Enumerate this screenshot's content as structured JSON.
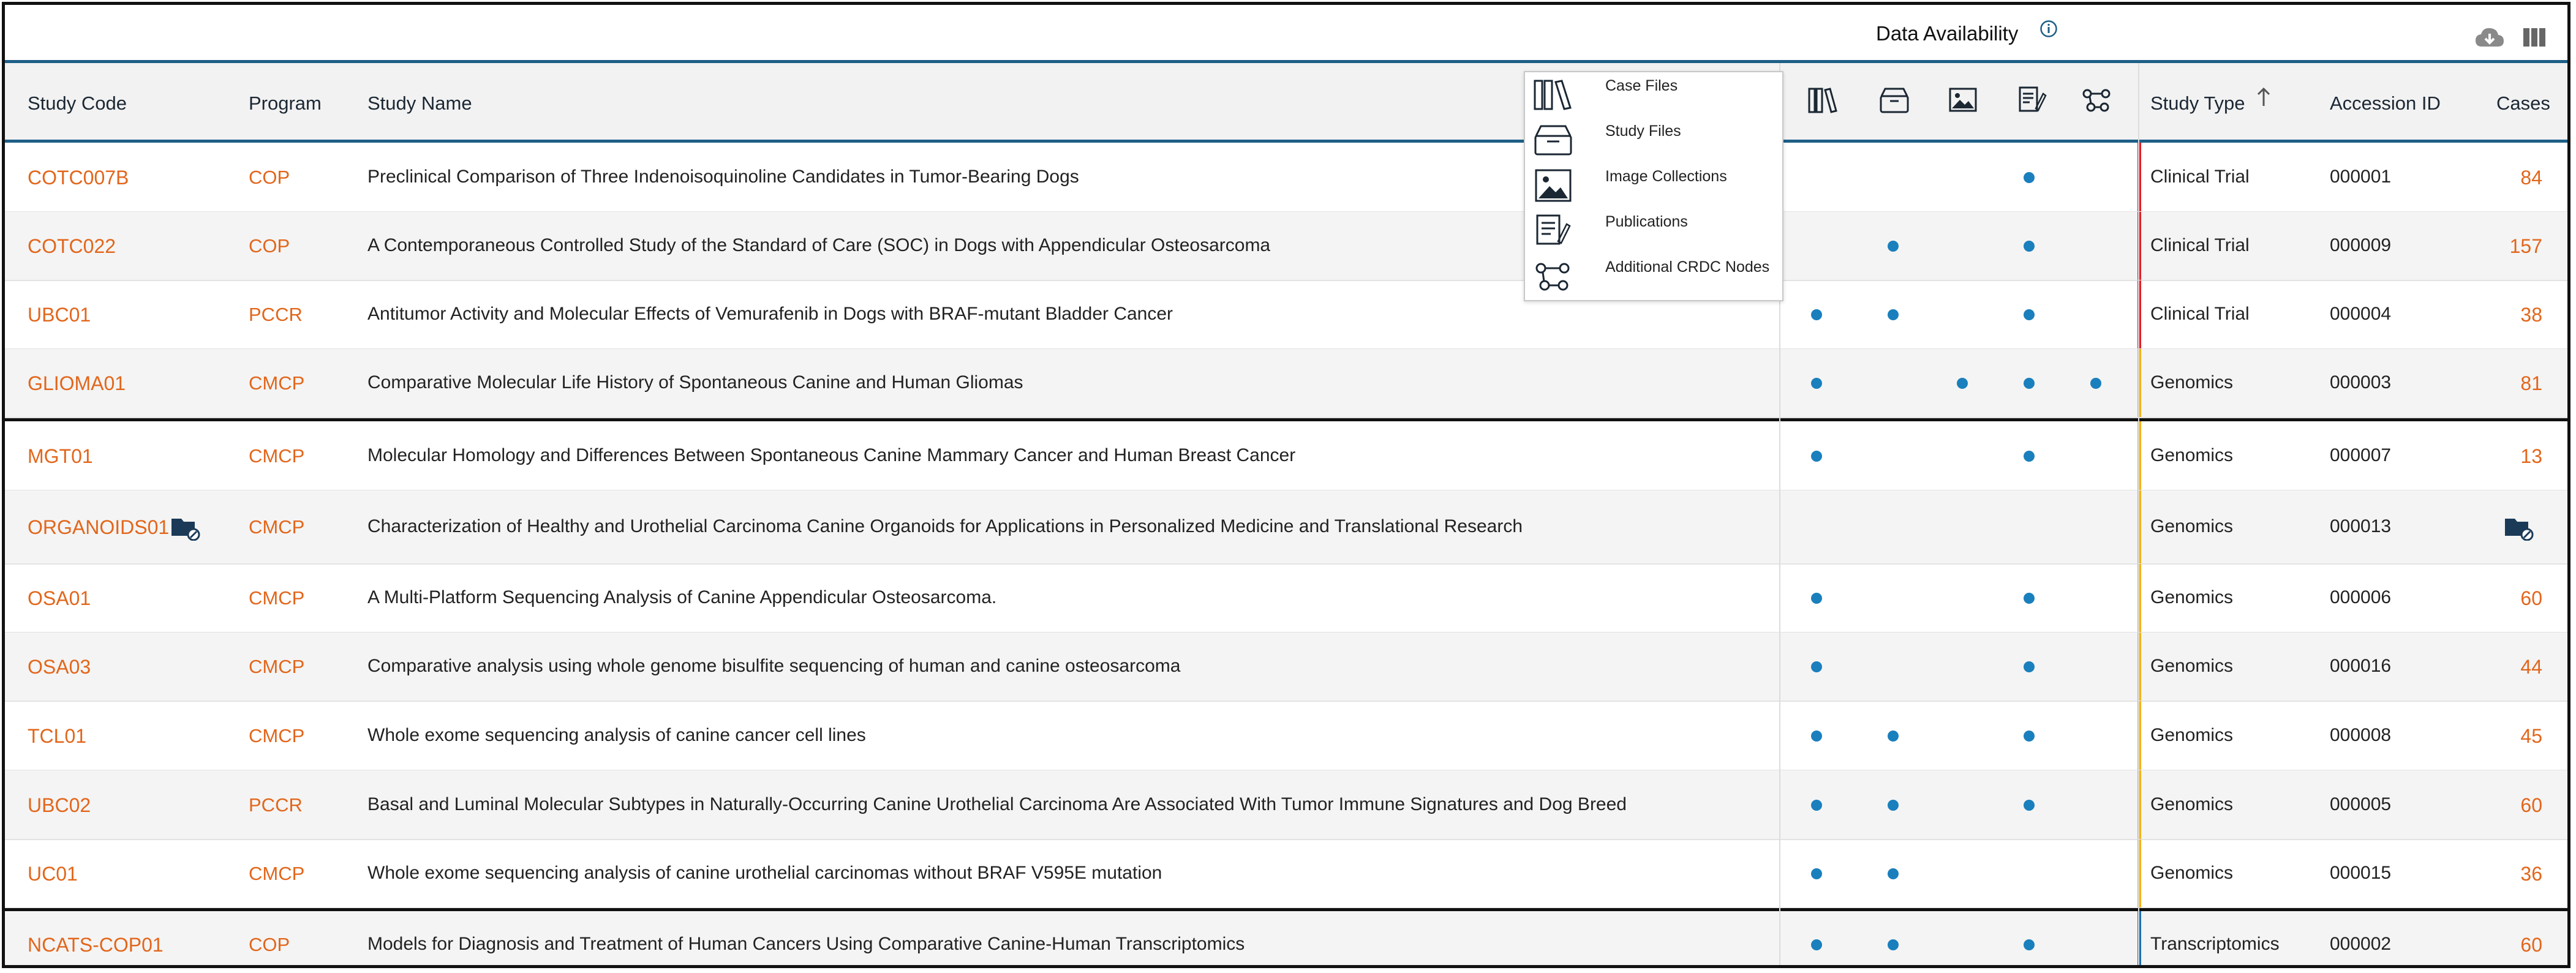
{
  "header": {
    "data_availability_title": "Data Availability",
    "columns": {
      "study_code": "Study Code",
      "program": "Program",
      "study_name": "Study Name",
      "study_type": "Study Type",
      "accession_id": "Accession ID",
      "cases": "Cases"
    },
    "data_icons": [
      "case-files-icon",
      "study-files-icon",
      "image-collections-icon",
      "publications-icon",
      "additional-crdc-nodes-icon"
    ],
    "sorted_column": "Study Type",
    "sort_direction": "ascending"
  },
  "legend": {
    "items": [
      {
        "icon": "case-files-icon",
        "label": "Case Files"
      },
      {
        "icon": "study-files-icon",
        "label": "Study Files"
      },
      {
        "icon": "image-collections-icon",
        "label": "Image Collections"
      },
      {
        "icon": "publications-icon",
        "label": "Publications"
      },
      {
        "icon": "additional-crdc-nodes-icon",
        "label": "Additional CRDC Nodes"
      }
    ]
  },
  "colors": {
    "accent": "#e2661b",
    "header_rule": "#1e5f87",
    "dot": "#1a7fbd",
    "clinical_trial_bar": "#e0202a",
    "genomics_bar": "#f2b21a",
    "transcriptomics_bar": "#1e6fb0"
  },
  "rows": [
    {
      "code": "COTC007B",
      "program": "COP",
      "name": "Preclinical Comparison of Three Indenoisoquinoline Candidates in Tumor-Bearing Dogs",
      "avail": [
        0,
        0,
        0,
        1,
        0
      ],
      "type": "Clinical Trial",
      "accession": "000001",
      "cases": "84"
    },
    {
      "code": "COTC022",
      "program": "COP",
      "name": "A Contemporaneous Controlled Study of the Standard of Care (SOC) in Dogs with Appendicular Osteosarcoma",
      "avail": [
        0,
        1,
        0,
        1,
        0
      ],
      "type": "Clinical Trial",
      "accession": "000009",
      "cases": "157"
    },
    {
      "code": "UBC01",
      "program": "PCCR",
      "name": "Antitumor Activity and Molecular Effects of Vemurafenib in Dogs with BRAF-mutant Bladder Cancer",
      "avail": [
        1,
        1,
        0,
        1,
        0
      ],
      "type": "Clinical Trial",
      "accession": "000004",
      "cases": "38"
    },
    {
      "code": "GLIOMA01",
      "program": "CMCP",
      "name": "Comparative Molecular Life History of Spontaneous Canine and Human Gliomas",
      "avail": [
        1,
        0,
        1,
        1,
        1
      ],
      "type": "Genomics",
      "accession": "000003",
      "cases": "81"
    },
    {
      "code": "MGT01",
      "program": "CMCP",
      "name": "Molecular Homology and Differences Between Spontaneous Canine Mammary Cancer and Human Breast Cancer",
      "avail": [
        1,
        0,
        0,
        1,
        0
      ],
      "type": "Genomics",
      "accession": "000007",
      "cases": "13"
    },
    {
      "code": "ORGANOIDS01",
      "program": "CMCP",
      "name": "Characterization of Healthy and Urothelial Carcinoma Canine Organoids for Applications in Personalized Medicine and Translational Research",
      "avail": [
        0,
        0,
        0,
        0,
        0
      ],
      "type": "Genomics",
      "accession": "000013",
      "cases": ""
    },
    {
      "code": "OSA01",
      "program": "CMCP",
      "name": "A Multi-Platform Sequencing Analysis of Canine Appendicular Osteosarcoma.",
      "avail": [
        1,
        0,
        0,
        1,
        0
      ],
      "type": "Genomics",
      "accession": "000006",
      "cases": "60"
    },
    {
      "code": "OSA03",
      "program": "CMCP",
      "name": "Comparative analysis using whole genome bisulfite sequencing of human and canine osteosarcoma",
      "avail": [
        1,
        0,
        0,
        1,
        0
      ],
      "type": "Genomics",
      "accession": "000016",
      "cases": "44"
    },
    {
      "code": "TCL01",
      "program": "CMCP",
      "name": "Whole exome sequencing analysis of canine cancer cell lines",
      "avail": [
        1,
        1,
        0,
        1,
        0
      ],
      "type": "Genomics",
      "accession": "000008",
      "cases": "45"
    },
    {
      "code": "UBC02",
      "program": "PCCR",
      "name": "Basal and Luminal Molecular Subtypes in Naturally-Occurring Canine Urothelial Carcinoma Are Associated With Tumor Immune Signatures and Dog Breed",
      "avail": [
        1,
        1,
        0,
        1,
        0
      ],
      "type": "Genomics",
      "accession": "000005",
      "cases": "60"
    },
    {
      "code": "UC01",
      "program": "CMCP",
      "name": "Whole exome sequencing analysis of canine urothelial carcinomas without BRAF V595E mutation",
      "avail": [
        1,
        1,
        0,
        0,
        0
      ],
      "type": "Genomics",
      "accession": "000015",
      "cases": "36"
    },
    {
      "code": "NCATS-COP01",
      "program": "COP",
      "name": "Models for Diagnosis and Treatment of Human Cancers Using Comparative Canine-Human Transcriptomics",
      "avail": [
        1,
        1,
        0,
        1,
        0
      ],
      "type": "Transcriptomics",
      "accession": "000002",
      "cases": "60"
    }
  ]
}
